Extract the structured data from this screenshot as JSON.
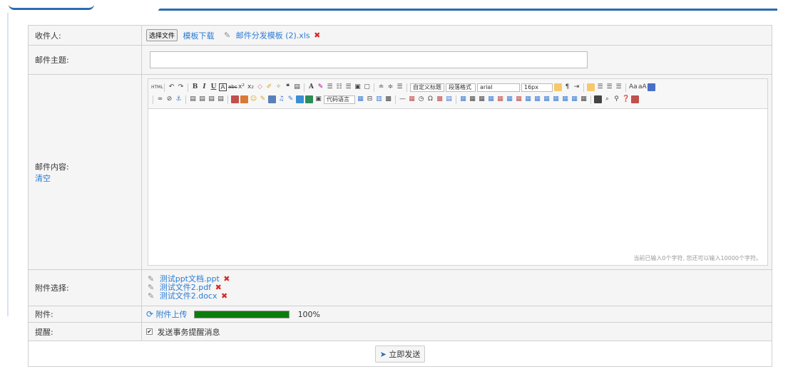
{
  "form": {
    "recipient_label": "收件人:",
    "file_button": "选择文件",
    "template_link": "模板下载",
    "recipient_file": "邮件分发模板 (2).xls",
    "subject_label": "邮件主题:",
    "subject_value": "",
    "content_label": "邮件内容:",
    "clear_link": "清空",
    "attachment_label": "附件选择:",
    "attachments": [
      "测试ppt文档.ppt",
      "测试文件2.pdf",
      "测试文件2.docx"
    ],
    "file_label": "附件:",
    "upload_link": "附件上传",
    "upload_progress": 1.0,
    "upload_percent": "100%",
    "reminder_label": "提醒:",
    "reminder_checked": true,
    "reminder_text": "发送事务提醒消息",
    "send_button": "立即发送"
  },
  "editor": {
    "heading_select": "自定义标题",
    "paragraph_select": "段落格式",
    "font_select": "arial",
    "size_select": "16px",
    "code_select": "代码语言",
    "counter_text": "当前已输入0个字符, 您还可以输入10000个字符。"
  },
  "colors": {
    "accent": "#2b6cb0",
    "link": "#2a7bd4",
    "progress": "#0c7d0c",
    "delete": "#d52a2a"
  }
}
